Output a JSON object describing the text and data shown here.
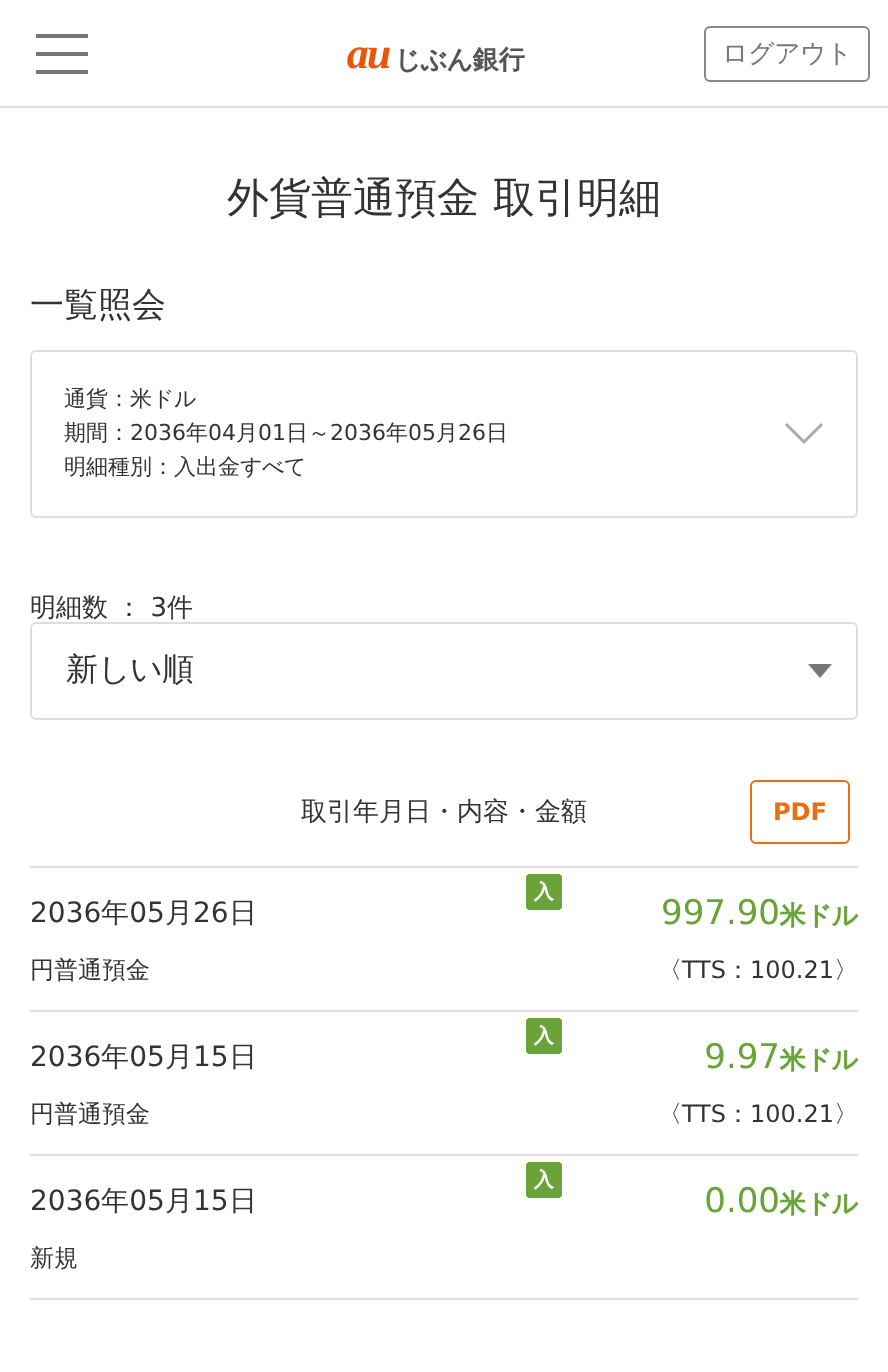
{
  "header": {
    "logo_mark": "au",
    "logo_text": "じぶん銀行",
    "logout_button": "ログアウト"
  },
  "page_title": "外貨普通預金 取引明細",
  "section_title": "一覧照会",
  "filter": {
    "lines": [
      "通貨：米ドル",
      "期間：2036年04月01日～2036年05月26日",
      "明細種別：入出金すべて"
    ],
    "expanded": false
  },
  "count": "明細数 ： 3件",
  "sort": {
    "value": "新しい順"
  },
  "table": {
    "heading": "取引年月日・内容・金額",
    "pdf_button": "PDF",
    "rows": [
      {
        "date": "2036年05月26日",
        "tag": "入",
        "amount": "997.90",
        "unit": "米ドル",
        "description": "円普通預金",
        "rate": "〈TTS：100.21〉"
      },
      {
        "date": "2036年05月15日",
        "tag": "入",
        "amount": "9.97",
        "unit": "米ドル",
        "description": "円普通預金",
        "rate": "〈TTS：100.21〉"
      },
      {
        "date": "2036年05月15日",
        "tag": "入",
        "amount": "0.00",
        "unit": "米ドル",
        "description": "新規"
      }
    ]
  }
}
